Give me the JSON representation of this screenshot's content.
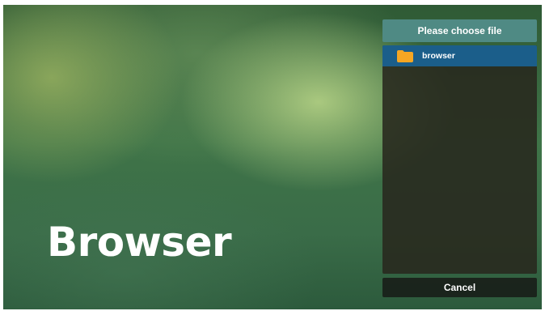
{
  "wallpaper": {
    "title": "Browser"
  },
  "dialog": {
    "title": "Please choose file",
    "items": [
      {
        "label": "browser",
        "icon": "folder-icon",
        "selected": true
      }
    ],
    "cancel_label": "Cancel"
  },
  "colors": {
    "header": "#4f8a84",
    "selected_row": "#1b5e8a",
    "folder": "#f5a623",
    "panel": "#28281e"
  }
}
